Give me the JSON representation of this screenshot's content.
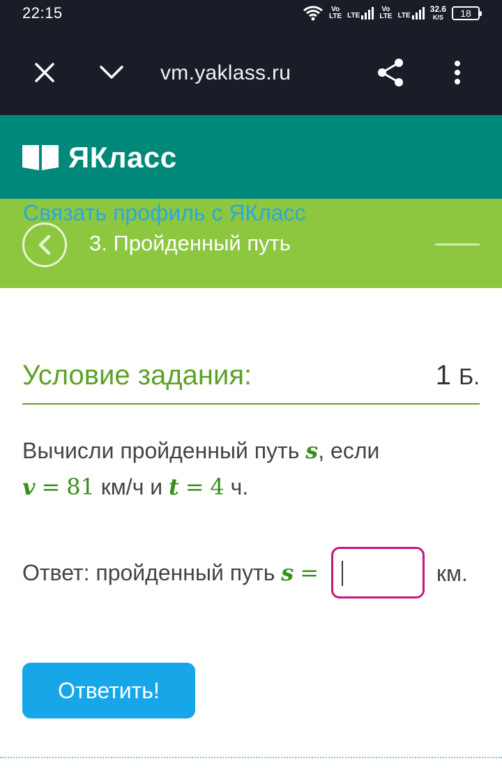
{
  "status": {
    "time": "22:15",
    "volte1_top": "Vo",
    "volte1_bottom": "LTE",
    "lte1": "LTE",
    "volte2_top": "Vo",
    "volte2_bottom": "LTE",
    "lte2": "LTE",
    "speed_value": "32.6",
    "speed_unit": "K/S",
    "battery": "18"
  },
  "browser": {
    "url": "vm.yaklass.ru",
    "icons": [
      "close-icon",
      "chevron-down-icon",
      "share-icon",
      "more-vertical-icon"
    ]
  },
  "brand": {
    "name": "ЯКласс",
    "icon": "book-icon"
  },
  "lesson": {
    "profile_link": "Связать профиль с ЯКласс",
    "title": "3. Пройденный путь"
  },
  "condition": {
    "title": "Условие задания:",
    "points_value": "1",
    "points_unit": "Б."
  },
  "task": {
    "text_1": "Вычисли пройденный путь",
    "var_s": "s",
    "text_2": ", если",
    "var_v": "v",
    "equals": "=",
    "v_value": "81",
    "v_unit": "км/ч",
    "and": "и",
    "var_t": "t",
    "t_value": "4",
    "t_unit": "ч."
  },
  "answer": {
    "label": "Ответ: пройденный путь",
    "var_s": "s",
    "equals": "=",
    "value": "",
    "unit": "км."
  },
  "submit_label": "Ответить!",
  "colors": {
    "status_bg": "#1a1d27",
    "brand_green": "#00897b",
    "lesson_green": "#8dc63f",
    "title_green": "#5ea125",
    "input_border": "#c2187a",
    "button_blue": "#17a7e8",
    "link_blue": "#29a8e0"
  }
}
